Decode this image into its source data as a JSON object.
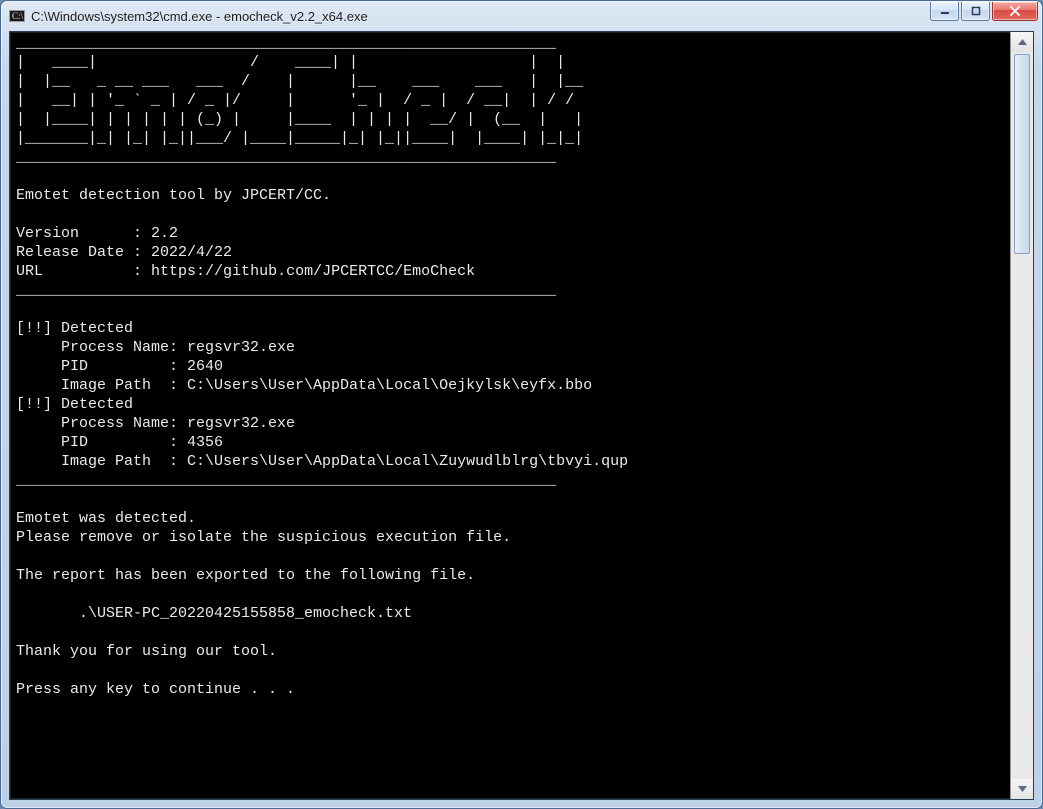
{
  "titlebar": {
    "title": "C:\\Windows\\system32\\cmd.exe - emocheck_v2.2_x64.exe"
  },
  "console": {
    "ascii": [
      "____________________________________________________________",
      "|   ____|                 /    ____| |                   |  |",
      "|  |__   _ __ ___   ___  /    |      |__    ___    ___   |  |__",
      "|   __| | '_ ` _ | / _ |/     |      '_ |  / _ |  / __|  | / /",
      "|  |____| | | | | | (_) |     |____  | | | |  __/ |  (__  |   |",
      "|_______|_| |_| |_||___/ |____|_____|_| |_||____|  |____| |_|_|",
      "____________________________________________________________"
    ],
    "tagline": "Emotet detection tool by JPCERT/CC.",
    "meta": {
      "version_label": "Version",
      "version_value": "2.2",
      "release_label": "Release Date",
      "release_value": "2022/4/22",
      "url_label": "URL",
      "url_value": "https://github.com/JPCERTCC/EmoCheck"
    },
    "sep": "____________________________________________________________",
    "detections": [
      {
        "header": "[!!] Detected",
        "proc_label": "     Process Name: ",
        "proc": "regsvr32.exe",
        "pid_label": "     PID         : ",
        "pid": "2640",
        "path_label": "     Image Path  : ",
        "path": "C:\\Users\\User\\AppData\\Local\\Oejkylsk\\eyfx.bbo"
      },
      {
        "header": "[!!] Detected",
        "proc_label": "     Process Name: ",
        "proc": "regsvr32.exe",
        "pid_label": "     PID         : ",
        "pid": "4356",
        "path_label": "     Image Path  : ",
        "path": "C:\\Users\\User\\AppData\\Local\\Zuywudlblrg\\tbvyi.qup"
      }
    ],
    "summary1": "Emotet was detected.",
    "summary2": "Please remove or isolate the suspicious execution file.",
    "report_line": "The report has been exported to the following file.",
    "report_file": "       .\\USER-PC_20220425155858_emocheck.txt",
    "thanks": "Thank you for using our tool.",
    "prompt": "Press any key to continue . . ."
  }
}
